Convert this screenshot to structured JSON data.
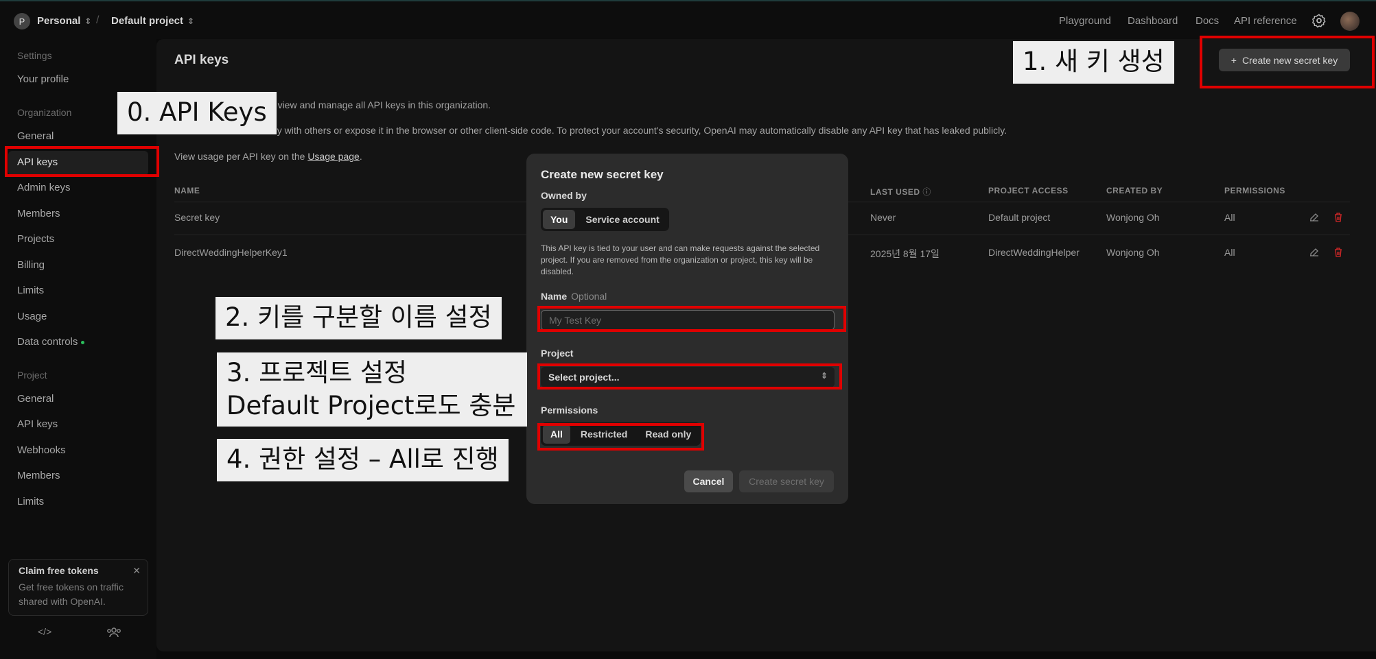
{
  "topbar": {
    "workspace_initial": "P",
    "workspace": "Personal",
    "project": "Default project",
    "nav": [
      "Playground",
      "Dashboard",
      "Docs",
      "API reference"
    ]
  },
  "sidebar": {
    "settings_header": "Settings",
    "your_profile": "Your profile",
    "org_header": "Organization",
    "org_items": [
      "General",
      "API keys",
      "Admin keys",
      "Members",
      "Projects",
      "Billing",
      "Limits",
      "Usage",
      "Data controls"
    ],
    "project_header": "Project",
    "project_items": [
      "General",
      "API keys",
      "Webhooks",
      "Members",
      "Limits"
    ],
    "claim": {
      "title": "Claim free tokens",
      "text": "Get free tokens on traffic shared with OpenAI."
    }
  },
  "main": {
    "title": "API keys",
    "create_button": "Create new secret key",
    "desc1": "to view and manage all API keys in this organization.",
    "desc2": "key with others or expose it in the browser or other client-side code. To protect your account's security, OpenAI may automatically disable any API key that has leaked publicly.",
    "desc3_prefix": "View usage per API key on the ",
    "desc3_link": "Usage page",
    "desc3_suffix": ".",
    "columns": [
      "NAME",
      "LAST USED",
      "PROJECT ACCESS",
      "CREATED BY",
      "PERMISSIONS"
    ],
    "rows": [
      {
        "name": "Secret key",
        "last_used": "Never",
        "project_access": "Default project",
        "created_by": "Wonjong Oh",
        "permissions": "All"
      },
      {
        "name": "DirectWeddingHelperKey1",
        "last_used": "2025년 8월 17일",
        "project_access": "DirectWeddingHelper",
        "created_by": "Wonjong Oh",
        "permissions": "All"
      }
    ]
  },
  "modal": {
    "title": "Create new secret key",
    "owned_by_label": "Owned by",
    "owned_by_options": [
      "You",
      "Service account"
    ],
    "owned_by_selected": "You",
    "note": "This API key is tied to your user and can make requests against the selected project. If you are removed from the organization or project, this key will be disabled.",
    "name_label": "Name",
    "name_optional": "Optional",
    "name_placeholder": "My Test Key",
    "project_label": "Project",
    "project_placeholder": "Select project...",
    "permissions_label": "Permissions",
    "permissions_options": [
      "All",
      "Restricted",
      "Read only"
    ],
    "permissions_selected": "All",
    "cancel": "Cancel",
    "create": "Create secret key"
  },
  "annotations": {
    "a0": "0. API Keys",
    "a1": "1. 새 키 생성",
    "a2": "2. 키를 구분할 이름 설정",
    "a3_line1": "3. 프로젝트 설정",
    "a3_line2": "Default Project로도 충분",
    "a4": "4. 권한 설정 – All로 진행",
    "box_color": "#e00000"
  }
}
